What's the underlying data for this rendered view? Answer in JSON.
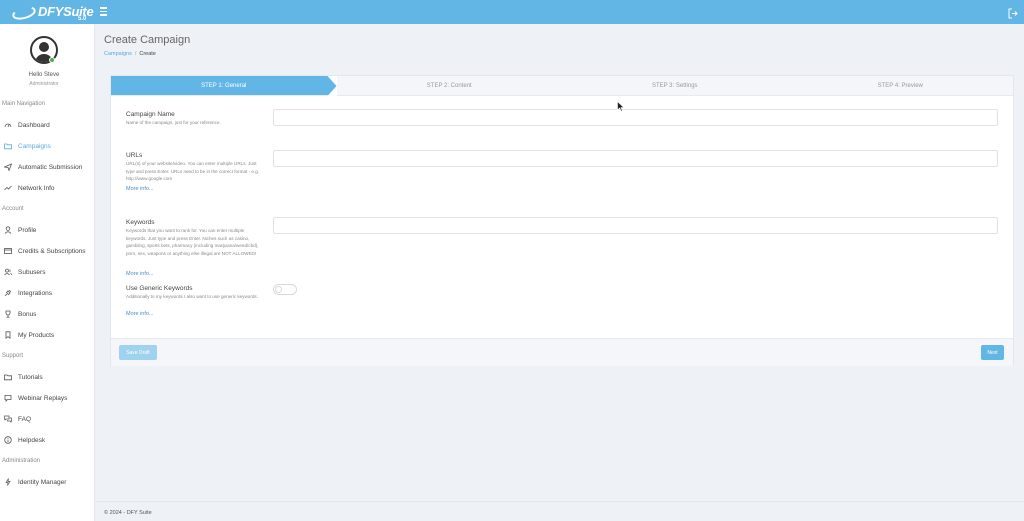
{
  "topbar": {
    "logo_text": "DFYSuite",
    "logo_version": "5.0",
    "background": "#62b6e5"
  },
  "sidebar": {
    "user_name": "Hello Steve",
    "user_role": "Administrator",
    "sections": {
      "main": "Main Navigation",
      "account": "Account",
      "support": "Support",
      "administration": "Administration"
    },
    "items": {
      "dashboard": "Dashboard",
      "campaigns": "Campaigns",
      "automatic_submission": "Automatic Submission",
      "network_info": "Network Info",
      "profile": "Profile",
      "credits": "Credits & Subscriptions",
      "subusers": "Subusers",
      "integrations": "Integrations",
      "bonus": "Bonus",
      "my_products": "My Products",
      "tutorials": "Tutorials",
      "webinar_replays": "Webinar Replays",
      "faq": "FAQ",
      "helpdesk": "Helpdesk",
      "identity_manager": "Identity Manager"
    },
    "active_color": "#5aa9df"
  },
  "page": {
    "title": "Create Campaign",
    "breadcrumb_root": "Campaigns",
    "breadcrumb_sep": "/",
    "breadcrumb_current": "Create"
  },
  "wizard": {
    "steps": [
      "STEP 1: General",
      "STEP 2: Content",
      "STEP 3: Settings",
      "STEP 4: Preview"
    ],
    "active_step": 1
  },
  "form": {
    "campaign_name": {
      "label": "Campaign Name",
      "help": "Name of the campaign, just for your reference.",
      "value": ""
    },
    "urls": {
      "label": "URLs",
      "help": "URL(s) of your website/video. You can enter multiple URLs. Just type and press Enter. URLs need to be in the correct format - e.g. http://www.google.com",
      "more": "More info...",
      "value": ""
    },
    "keywords": {
      "label": "Keywords",
      "help": "Keywords that you want to rank for. You can enter multiple keywords. Just type and press Enter. Niches such as casino, gambling, sports bets, pharmacy (including marijuana/weed/cbd), porn, sex, weapons or anything else illegal are NOT ALLOWED!",
      "more": "More info...",
      "value": ""
    },
    "generic_keywords": {
      "label": "Use Generic Keywords",
      "help": "Additionally to my keywords I also want to use generic keywords.",
      "more": "More info...",
      "enabled": false
    }
  },
  "buttons": {
    "save_draft": "Save Draft",
    "next": "Next"
  },
  "footer": {
    "text": "© 2024 - DFY Suite"
  }
}
